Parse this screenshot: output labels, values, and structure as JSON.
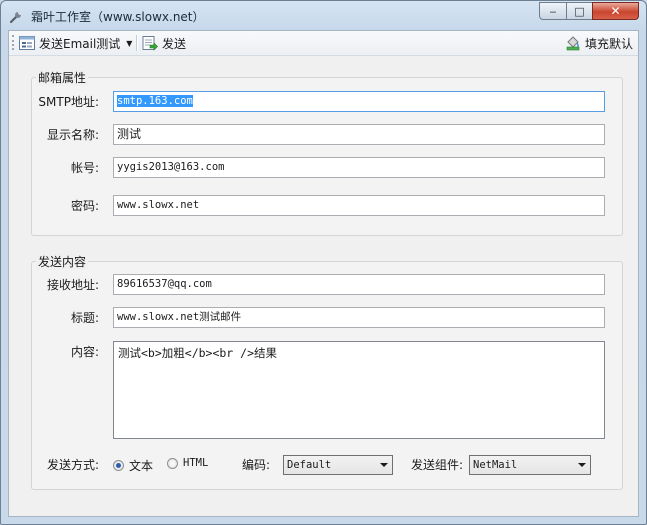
{
  "window": {
    "title": "霜叶工作室（www.slowx.net）",
    "controls": {
      "minimize": "‒",
      "maximize": "□",
      "close": "✕"
    }
  },
  "toolbar": {
    "test_email_label": "发送Email测试",
    "send_label": "发送",
    "fill_default_label": "填充默认"
  },
  "mailbox": {
    "group_title": "邮箱属性",
    "smtp_label": "SMTP地址:",
    "smtp_value": "smtp.163.com",
    "display_name_label": "显示名称:",
    "display_name_value": "测试",
    "account_label": "帐号:",
    "account_value": "yygis2013@163.com",
    "password_label": "密码:",
    "password_value": "www.slowx.net"
  },
  "content": {
    "group_title": "发送内容",
    "recipient_label": "接收地址:",
    "recipient_value": "89616537@qq.com",
    "subject_label": "标题:",
    "subject_value": "www.slowx.net测试邮件",
    "body_label": "内容:",
    "body_value": "测试<b>加粗</b><br />结果",
    "send_mode_label": "发送方式:",
    "mode_text": "文本",
    "mode_html": "HTML",
    "selected_mode": "文本",
    "encoding_label": "编码:",
    "encoding_value": "Default",
    "component_label": "发送组件:",
    "component_value": "NetMail"
  }
}
